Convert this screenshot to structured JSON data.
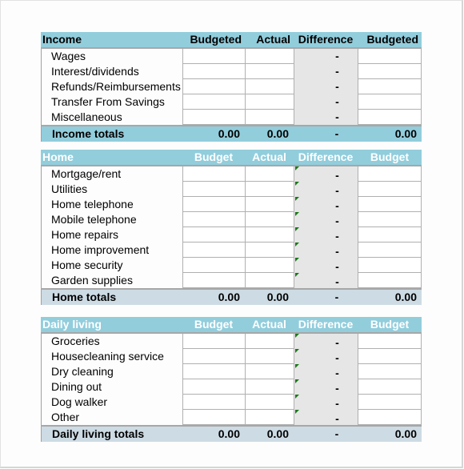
{
  "sections": {
    "income": {
      "header": [
        "Income",
        "Budgeted",
        "Actual",
        "Difference",
        "Budgeted"
      ],
      "rows": [
        {
          "label": "Wages",
          "difference": "-"
        },
        {
          "label": "Interest/dividends",
          "difference": "-"
        },
        {
          "label": "Refunds/Reimbursements",
          "difference": "-"
        },
        {
          "label": "Transfer From Savings",
          "difference": "-"
        },
        {
          "label": "Miscellaneous",
          "difference": "-"
        }
      ],
      "totals": {
        "label": "Income totals",
        "budgeted": "0.00",
        "actual": "0.00",
        "difference": "-",
        "budgeted2": "0.00"
      }
    },
    "home": {
      "header": [
        "Home",
        "Budget",
        "Actual",
        "Difference",
        "Budget"
      ],
      "rows": [
        {
          "label": "Mortgage/rent",
          "difference": "-"
        },
        {
          "label": "Utilities",
          "difference": "-"
        },
        {
          "label": "Home telephone",
          "difference": "-"
        },
        {
          "label": "Mobile telephone",
          "difference": "-"
        },
        {
          "label": "Home repairs",
          "difference": "-"
        },
        {
          "label": "Home improvement",
          "difference": "-"
        },
        {
          "label": "Home security",
          "difference": "-"
        },
        {
          "label": "Garden supplies",
          "difference": "-"
        }
      ],
      "totals": {
        "label": "Home totals",
        "budgeted": "0.00",
        "actual": "0.00",
        "difference": "-",
        "budgeted2": "0.00"
      }
    },
    "daily": {
      "header": [
        "Daily living",
        "Budget",
        "Actual",
        "Difference",
        "Budget"
      ],
      "rows": [
        {
          "label": "Groceries",
          "difference": "-"
        },
        {
          "label": "Housecleaning service",
          "difference": "-"
        },
        {
          "label": "Dry cleaning",
          "difference": "-"
        },
        {
          "label": "Dining out",
          "difference": "-"
        },
        {
          "label": "Dog walker",
          "difference": "-"
        },
        {
          "label": "Other",
          "difference": "-"
        }
      ],
      "totals": {
        "label": "Daily living totals",
        "budgeted": "0.00",
        "actual": "0.00",
        "difference": "-",
        "budgeted2": "0.00"
      }
    }
  },
  "colors": {
    "header_bg": "#92cddc",
    "difference_bg": "#e6e6e6",
    "totals_bg_income": "#92cddc",
    "totals_bg_other": "#cddbe4",
    "error_flag": "#1a7a1a"
  }
}
